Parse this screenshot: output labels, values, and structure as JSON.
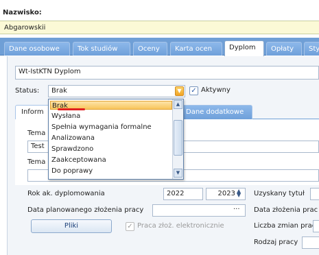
{
  "header": {
    "name_label": "Nazwisko:",
    "name_value": "Abgarowskii"
  },
  "tabs": [
    {
      "label": "Dane osobowe",
      "active": false
    },
    {
      "label": "Tok studiów",
      "active": false
    },
    {
      "label": "Oceny",
      "active": false
    },
    {
      "label": "Karta ocen",
      "active": false
    },
    {
      "label": "Dyplom",
      "active": true
    },
    {
      "label": "Opłaty",
      "active": false
    },
    {
      "label": "Sty",
      "active": false
    }
  ],
  "diploma": {
    "title_field": "Wt-IstKTN Dyplom",
    "status_label": "Status:",
    "status_value": "Brak",
    "active_label": "Aktywny",
    "active_checked": true
  },
  "subtabs": [
    {
      "label": "Inform"
    },
    {
      "label": "Dane dodatkowe"
    }
  ],
  "sub_fields": {
    "topic_label_1": "Tema",
    "topic_value_1": "Test",
    "topic_label_2": "Tema"
  },
  "dropdown": {
    "options": [
      "Brak",
      "Wysłana",
      "Spełnia wymagania formalne",
      "Analizowana",
      "Sprawdzono",
      "Zaakceptowana",
      "Do poprawy"
    ],
    "selected_index": 0
  },
  "form": {
    "year_label": "Rok ak. dyplomowania",
    "year_from": "2022",
    "year_to": "2023",
    "title_obtained_label": "Uzyskany tytuł",
    "planned_date_label": "Data planowanego złożenia pracy",
    "planned_date_btn": "···",
    "submit_date_label": "Data złożenia prac",
    "pliki_button": "Pliki",
    "electronic_label": "Praca złoż. elektronicznie",
    "changes_label": "Liczba zmian pracy",
    "work_type_label": "Rodzaj pracy"
  },
  "colors": {
    "tab_bar": "#6f9fd6",
    "name_field_bg": "#fbf9d6",
    "highlight": "#f8c55c",
    "underline": "#e02020"
  }
}
